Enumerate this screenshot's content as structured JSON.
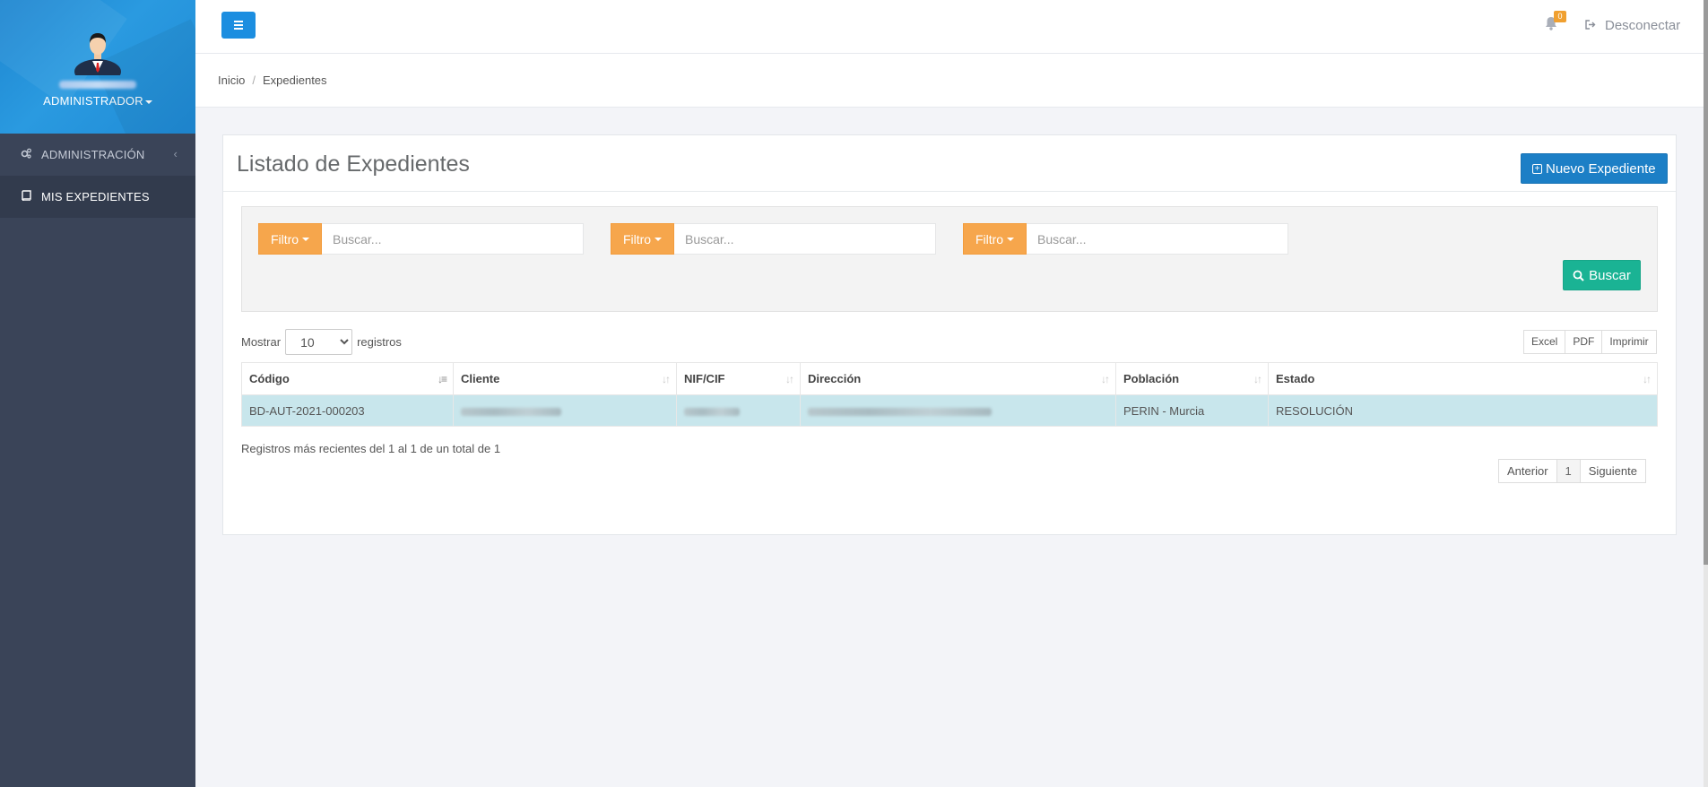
{
  "sidebar": {
    "role": "ADMINISTRADOR",
    "items": [
      {
        "label": "ADMINISTRACIÓN",
        "icon": "cogs-icon"
      },
      {
        "label": "MIS EXPEDIENTES",
        "icon": "book-icon"
      }
    ]
  },
  "header": {
    "notification_count": "0",
    "logout_label": "Desconectar"
  },
  "breadcrumb": {
    "home": "Inicio",
    "current": "Expedientes"
  },
  "main": {
    "title": "Listado de Expedientes",
    "new_button": "Nuevo Expediente",
    "filters": [
      {
        "button": "Filtro",
        "placeholder": "Buscar..."
      },
      {
        "button": "Filtro",
        "placeholder": "Buscar..."
      },
      {
        "button": "Filtro",
        "placeholder": "Buscar..."
      }
    ],
    "search_button": "Buscar",
    "length": {
      "prefix": "Mostrar",
      "value": "10",
      "suffix": "registros"
    },
    "exports": [
      "Excel",
      "PDF",
      "Imprimir"
    ],
    "table": {
      "columns": [
        "Código",
        "Cliente",
        "NIF/CIF",
        "Dirección",
        "Población",
        "Estado"
      ],
      "rows": [
        {
          "codigo": "BD-AUT-2021-000203",
          "poblacion": "PERIN - Murcia",
          "estado": "RESOLUCIÓN"
        }
      ]
    },
    "info": "Registros más recientes del 1 al 1 de un total de 1",
    "pagination": {
      "prev": "Anterior",
      "current": "1",
      "next": "Siguiente"
    }
  },
  "colors": {
    "sidebar_bg": "#3a4458",
    "primary": "#1c7fc6",
    "success": "#1ab394",
    "filter": "#f6a64c",
    "row_highlight": "#c8e6ec"
  }
}
